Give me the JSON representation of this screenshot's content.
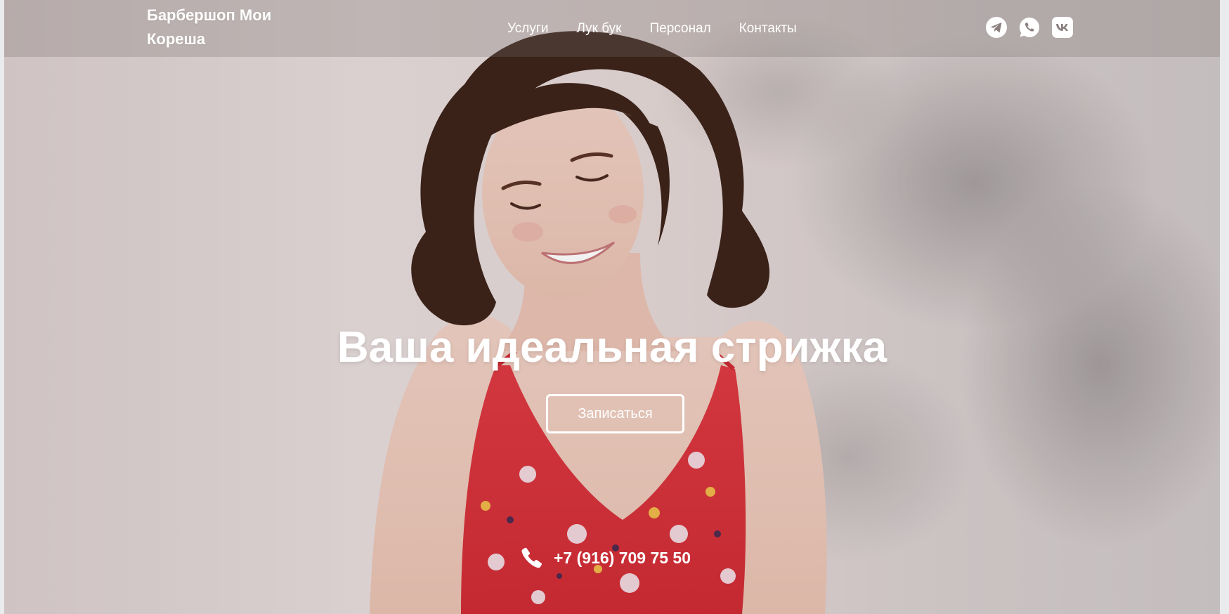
{
  "header": {
    "logo": "Барбершоп Мои Кореша",
    "nav": [
      {
        "label": "Услуги"
      },
      {
        "label": "Лук бук"
      },
      {
        "label": "Персонал"
      },
      {
        "label": "Контакты"
      }
    ],
    "socials": [
      "telegram-icon",
      "whatsapp-icon",
      "vk-icon"
    ]
  },
  "hero": {
    "title": "Ваша идеальная стрижка",
    "cta_label": "Записаться",
    "phone": "+7 (916) 709 75 50"
  },
  "colors": {
    "text": "#ffffff",
    "dress": "#d8303a",
    "hair": "#3a2218"
  }
}
